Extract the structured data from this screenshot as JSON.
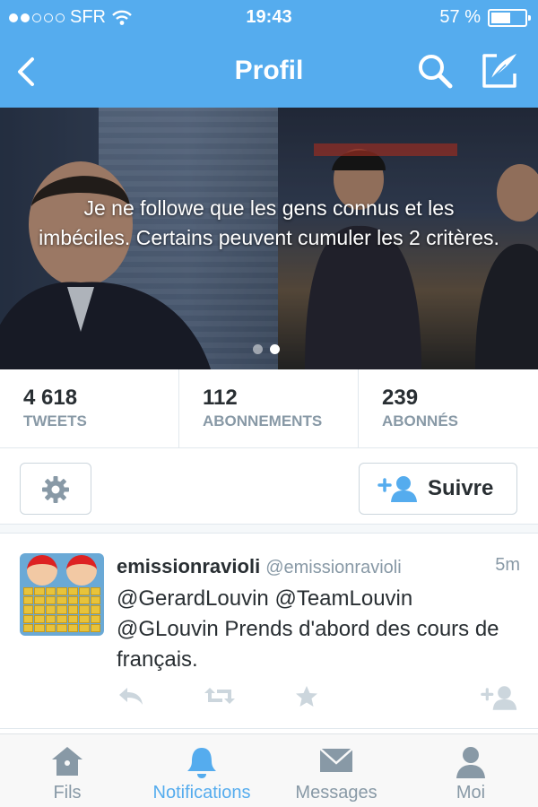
{
  "status_bar": {
    "carrier": "SFR",
    "time": "19:43",
    "battery": "57 %",
    "battery_level": 0.57
  },
  "nav": {
    "title": "Profil"
  },
  "profile": {
    "bio": "Je ne followe que les gens connus et les imbéciles. Certains peuvent cumuler les 2 critères.",
    "stats": [
      {
        "value": "4 618",
        "label": "TWEETS"
      },
      {
        "value": "112",
        "label": "ABONNEMENTS"
      },
      {
        "value": "239",
        "label": "ABONNÉS"
      }
    ],
    "follow_label": "Suivre"
  },
  "tweet": {
    "name": "emissionravioli",
    "handle": "@emissionravioli",
    "time": "5m",
    "text": "@GerardLouvin @TeamLouvin @GLouvin Prends d'abord des cours de français."
  },
  "tabs": [
    {
      "label": "Fils",
      "icon": "home-icon",
      "active": false
    },
    {
      "label": "Notifications",
      "icon": "bell-icon",
      "active": true
    },
    {
      "label": "Messages",
      "icon": "envelope-icon",
      "active": false
    },
    {
      "label": "Moi",
      "icon": "person-icon",
      "active": false
    }
  ],
  "colors": {
    "accent": "#55acee",
    "text": "#292f33",
    "muted": "#8899a6",
    "action_icon": "#ccd6dd"
  }
}
